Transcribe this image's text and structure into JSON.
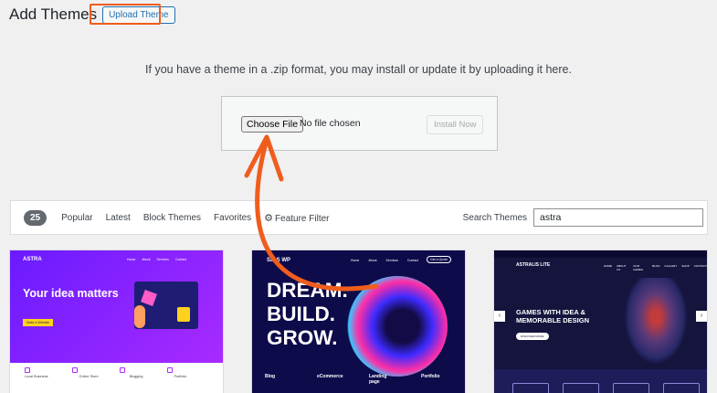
{
  "header": {
    "title": "Add Themes",
    "upload_button": "Upload Theme"
  },
  "upload": {
    "instructions": "If you have a theme in a .zip format, you may install or update it by uploading it here.",
    "choose_file": "Choose File",
    "no_file": "No file chosen",
    "install_now": "Install Now"
  },
  "filter": {
    "count": "25",
    "tabs": [
      "Popular",
      "Latest",
      "Block Themes",
      "Favorites"
    ],
    "feature_filter": "Feature Filter",
    "search_label": "Search Themes",
    "search_value": "astra"
  },
  "cards": {
    "astra": {
      "logo": "ASTRA",
      "nav": [
        "Home",
        "About",
        "Services",
        "Contact"
      ],
      "headline": "Your idea matters",
      "button": "Make a Website",
      "features": [
        "Local Business",
        "Online Store",
        "Blogging",
        "Portfolio"
      ]
    },
    "saas": {
      "logo": "SaaS WP",
      "nav": [
        "Home",
        "About",
        "Services",
        "Contact"
      ],
      "nav_button": "Get a Quote",
      "headline_1": "DREAM.",
      "headline_2": "BUILD.",
      "headline_3": "GROW.",
      "cols": [
        "Blog",
        "eCommerce",
        "Landing page",
        "Portfolio"
      ]
    },
    "astra_lite": {
      "logo": "ASTRALIS LITE",
      "nav": [
        "HOME",
        "ABOUT US",
        "OUR GAMES",
        "BLOG",
        "GALLERY",
        "SHOP",
        "CONTACT"
      ],
      "headline_1": "GAMES WITH IDEA &",
      "headline_2": "MEMORABLE DESIGN",
      "button": "DISCOVER MORE"
    }
  },
  "colors": {
    "highlight": "#ef5d1d",
    "link": "#2271b1"
  }
}
